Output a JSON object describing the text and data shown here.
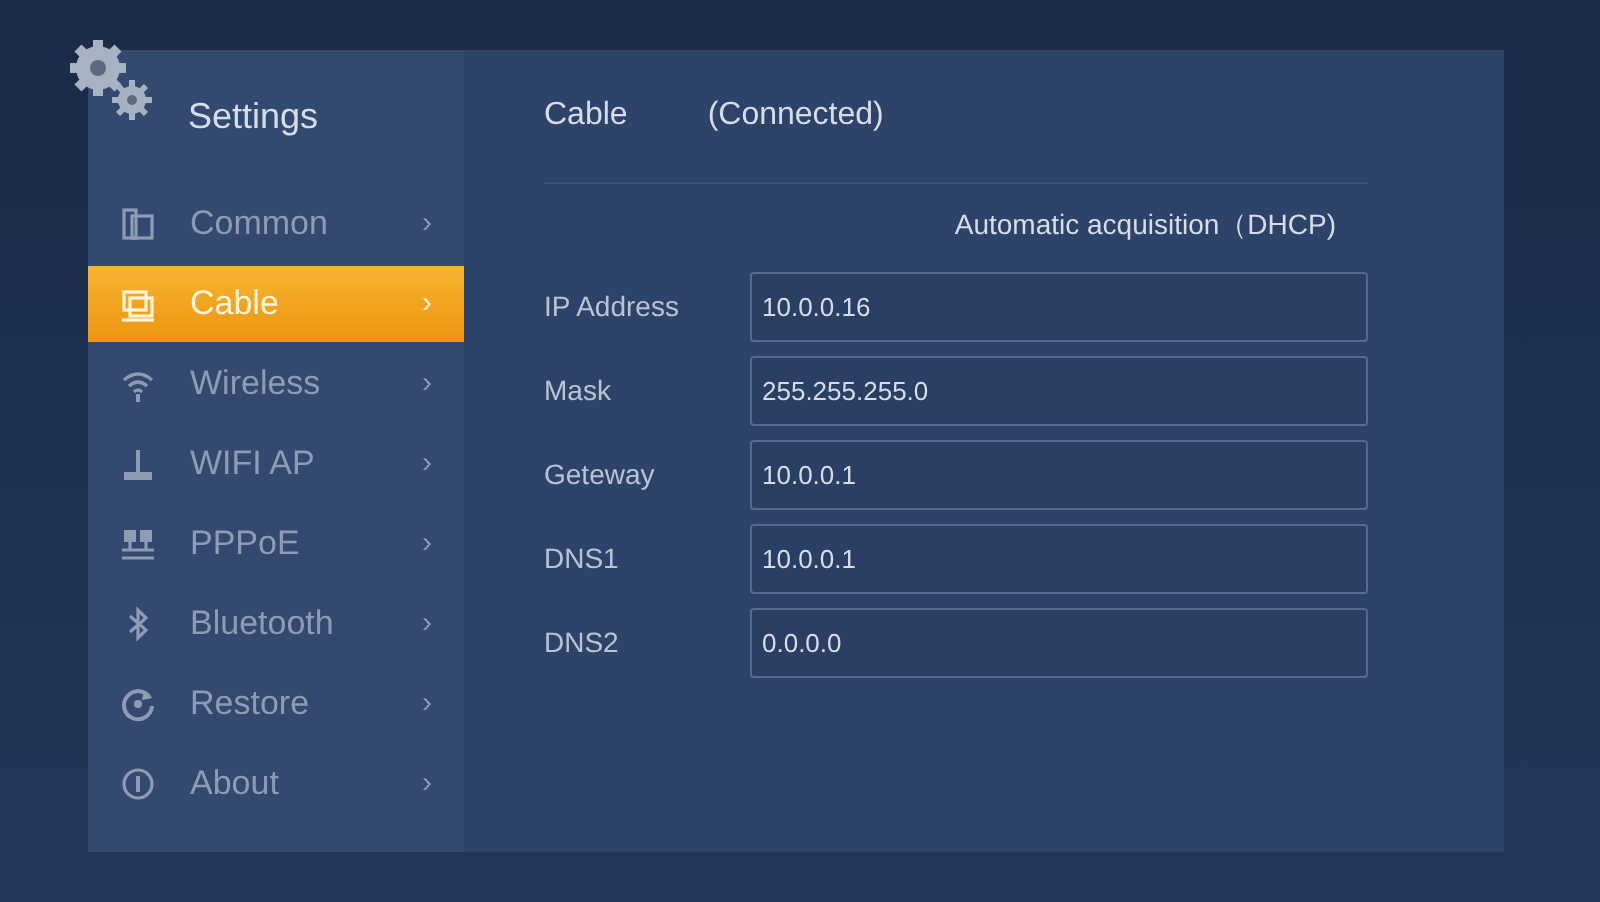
{
  "sidebar": {
    "title": "Settings",
    "items": [
      {
        "label": "Common",
        "chevron": "›",
        "selected": false
      },
      {
        "label": "Cable",
        "chevron": "›",
        "selected": true
      },
      {
        "label": "Wireless",
        "chevron": "›",
        "selected": false
      },
      {
        "label": "WIFI AP",
        "chevron": "›",
        "selected": false
      },
      {
        "label": "PPPoE",
        "chevron": "›",
        "selected": false
      },
      {
        "label": "Bluetooth",
        "chevron": "›",
        "selected": false
      },
      {
        "label": "Restore",
        "chevron": "›",
        "selected": false
      },
      {
        "label": "About",
        "chevron": "›",
        "selected": false
      }
    ]
  },
  "content": {
    "title": "Cable",
    "status": "(Connected)",
    "mode": "Automatic acquisition（DHCP)",
    "fields": [
      {
        "label": "IP Address",
        "value": "10.0.0.16"
      },
      {
        "label": "Mask",
        "value": "255.255.255.0"
      },
      {
        "label": "Geteway",
        "value": "10.0.0.1"
      },
      {
        "label": "DNS1",
        "value": "10.0.0.1"
      },
      {
        "label": "DNS2",
        "value": "0.0.0.0"
      }
    ]
  }
}
